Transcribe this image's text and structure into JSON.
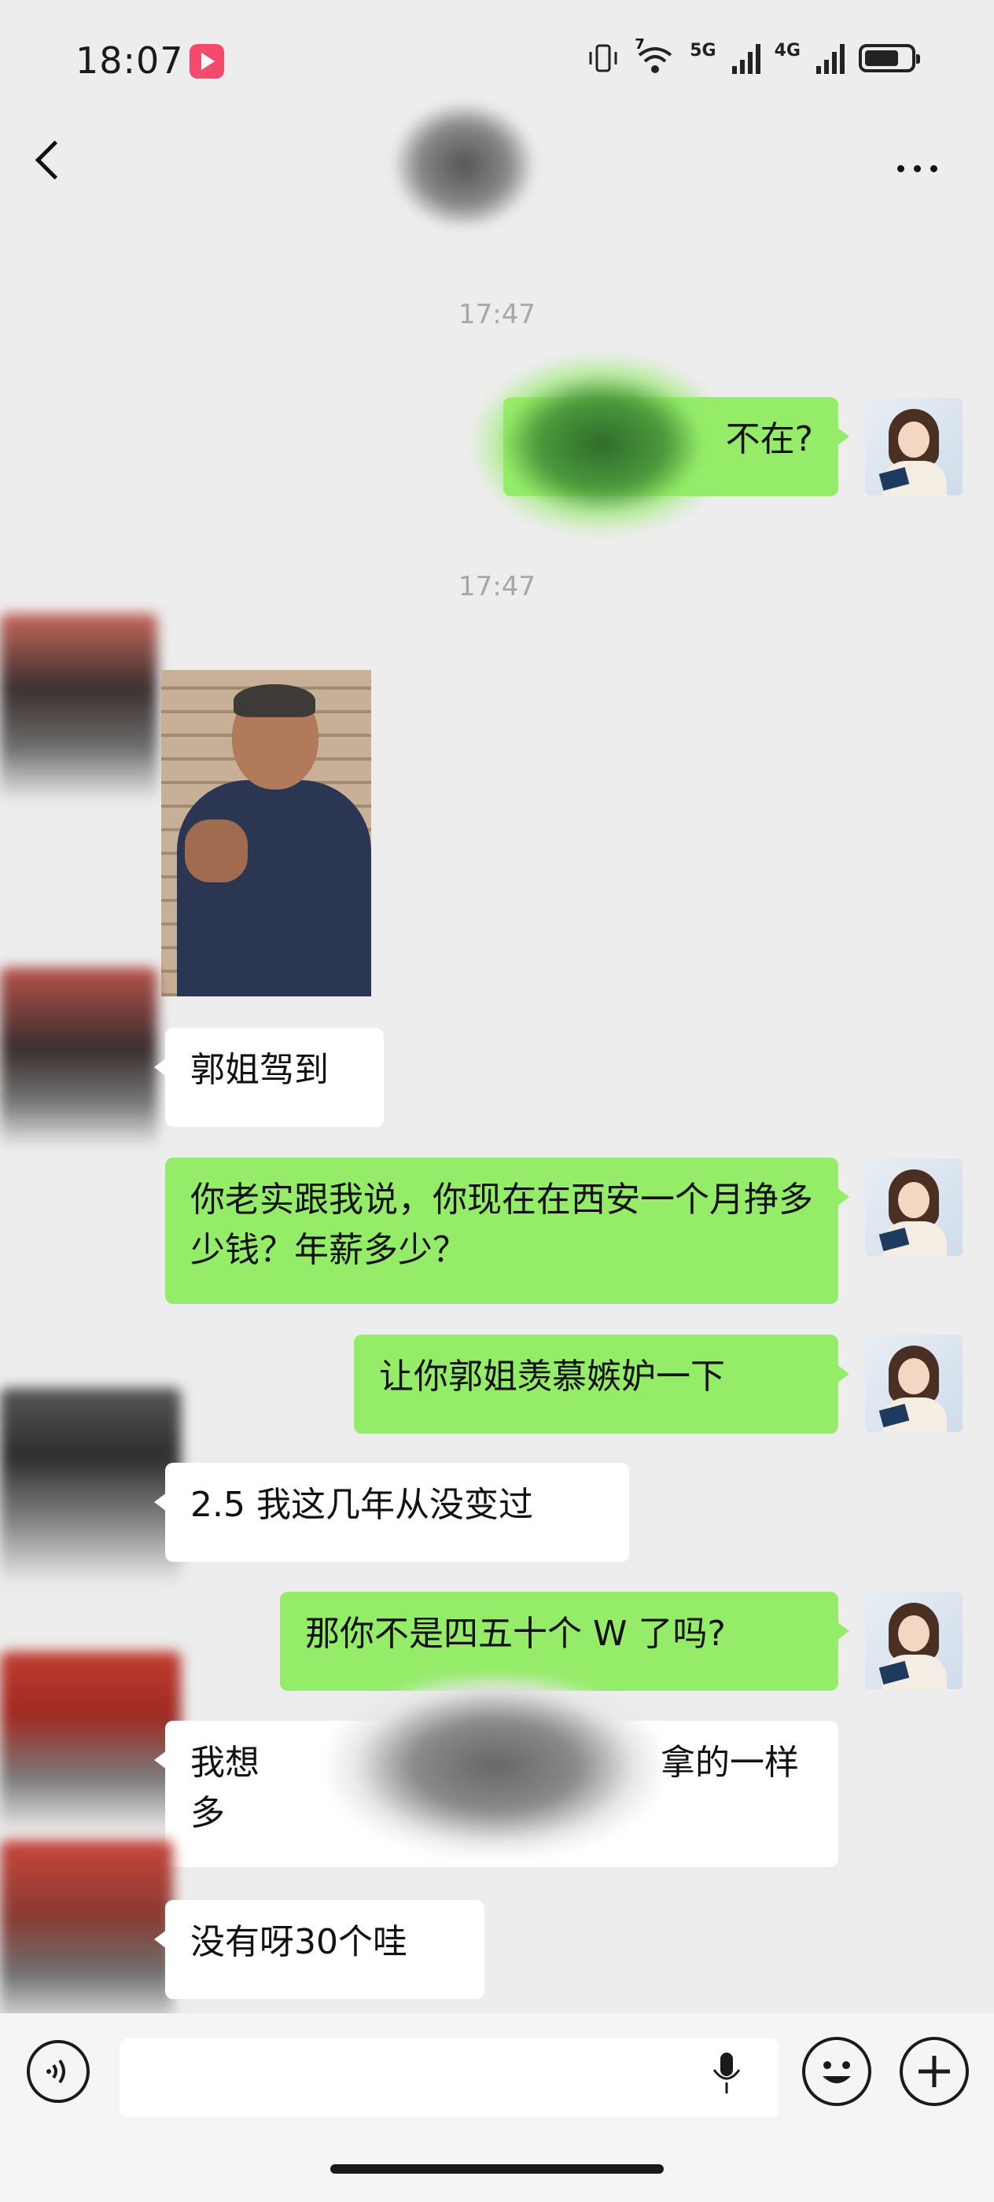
{
  "status_bar": {
    "time": "18:07",
    "network_a": "5G",
    "network_b": "4G",
    "wifi_tag": "7",
    "icons": [
      "screen-record-icon",
      "vibrate-icon",
      "wifi-icon",
      "signal-icon",
      "signal-icon",
      "battery-icon"
    ],
    "battery_fraction": 0.6
  },
  "nav": {
    "back_icon": "chevron-left-icon",
    "more_icon": "more-dots-icon"
  },
  "timestamps": [
    "17:47",
    "17:47"
  ],
  "messages": [
    {
      "side": "me",
      "type": "text",
      "text": "不在?"
    },
    {
      "side": "other",
      "type": "image",
      "icon": "photo-icon"
    },
    {
      "side": "other",
      "type": "text",
      "text": "郭姐驾到"
    },
    {
      "side": "me",
      "type": "text",
      "text": "你老实跟我说，你现在在西安一个月挣多少钱？年薪多少？"
    },
    {
      "side": "me",
      "type": "text",
      "text": "让你郭姐羡慕嫉妒一下"
    },
    {
      "side": "other",
      "type": "text",
      "text": "2.5 我这几年从没变过"
    },
    {
      "side": "me",
      "type": "text",
      "text": "那你不是四五十个 W 了吗?"
    },
    {
      "side": "other",
      "type": "text",
      "text_start": "我想",
      "text_end": "拿的一样",
      "text_line2": "多"
    },
    {
      "side": "other",
      "type": "text",
      "text": "没有呀30个哇"
    }
  ],
  "input_bar": {
    "voice_icon": "voice-toggle-icon",
    "mic_icon": "microphone-icon",
    "emoji_icon": "emoji-icon",
    "plus_icon": "plus-icon",
    "value": ""
  },
  "colors": {
    "background": "#ededed",
    "my_bubble": "#95ec69",
    "other_bubble": "#ffffff",
    "record_badge": "#f24b6d",
    "timestamp": "#a7a7a7"
  }
}
